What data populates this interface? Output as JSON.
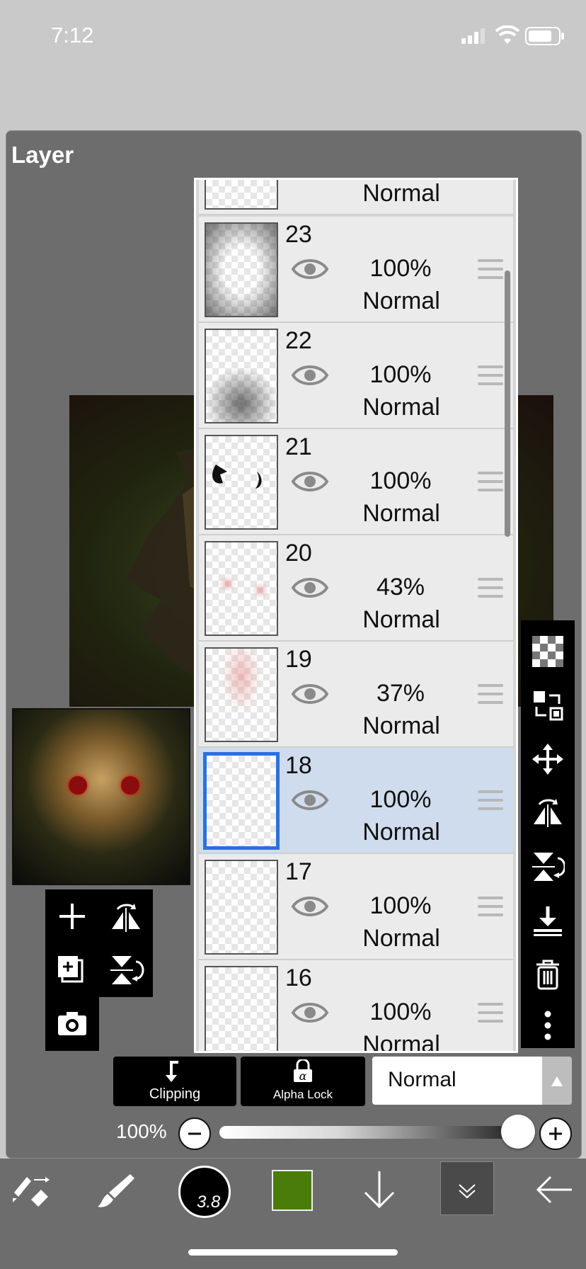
{
  "status_bar": {
    "time": "7:12"
  },
  "panel": {
    "title": "Layer"
  },
  "layers": [
    {
      "num": "",
      "opacity": "",
      "blend": "Normal",
      "selected": false
    },
    {
      "num": "23",
      "opacity": "100%",
      "blend": "Normal",
      "selected": false
    },
    {
      "num": "22",
      "opacity": "100%",
      "blend": "Normal",
      "selected": false
    },
    {
      "num": "21",
      "opacity": "100%",
      "blend": "Normal",
      "selected": false
    },
    {
      "num": "20",
      "opacity": "43%",
      "blend": "Normal",
      "selected": false
    },
    {
      "num": "19",
      "opacity": "37%",
      "blend": "Normal",
      "selected": false
    },
    {
      "num": "18",
      "opacity": "100%",
      "blend": "Normal",
      "selected": true
    },
    {
      "num": "17",
      "opacity": "100%",
      "blend": "Normal",
      "selected": false
    },
    {
      "num": "16",
      "opacity": "100%",
      "blend": "Normal",
      "selected": false
    }
  ],
  "layer_buttons": {
    "clipping": "Clipping",
    "alpha_lock": "Alpha Lock"
  },
  "blend_mode": {
    "selected": "Normal"
  },
  "opacity": {
    "label": "100%",
    "value": 1.0
  },
  "brush": {
    "size": "3.8"
  },
  "colors": {
    "current": "#4a7c0a",
    "selection": "#2e6fe0",
    "panel": "#6d6d6d"
  },
  "right_tools": [
    "transparency-icon",
    "swap-layer-icon",
    "move-icon",
    "flip-horizontal-icon",
    "flip-vertical-icon",
    "merge-down-icon",
    "trash-icon",
    "more-icon"
  ],
  "left_tools": [
    "add-layer-icon",
    "flip-layer-horizontal-icon",
    "duplicate-layer-icon",
    "flip-layer-vertical-icon",
    "camera-icon"
  ],
  "bottom_tools": [
    "transform-tool-icon",
    "brush-tool-icon",
    "brush-size-icon",
    "color-icon",
    "download-icon",
    "layers-toggle-icon",
    "back-icon"
  ]
}
